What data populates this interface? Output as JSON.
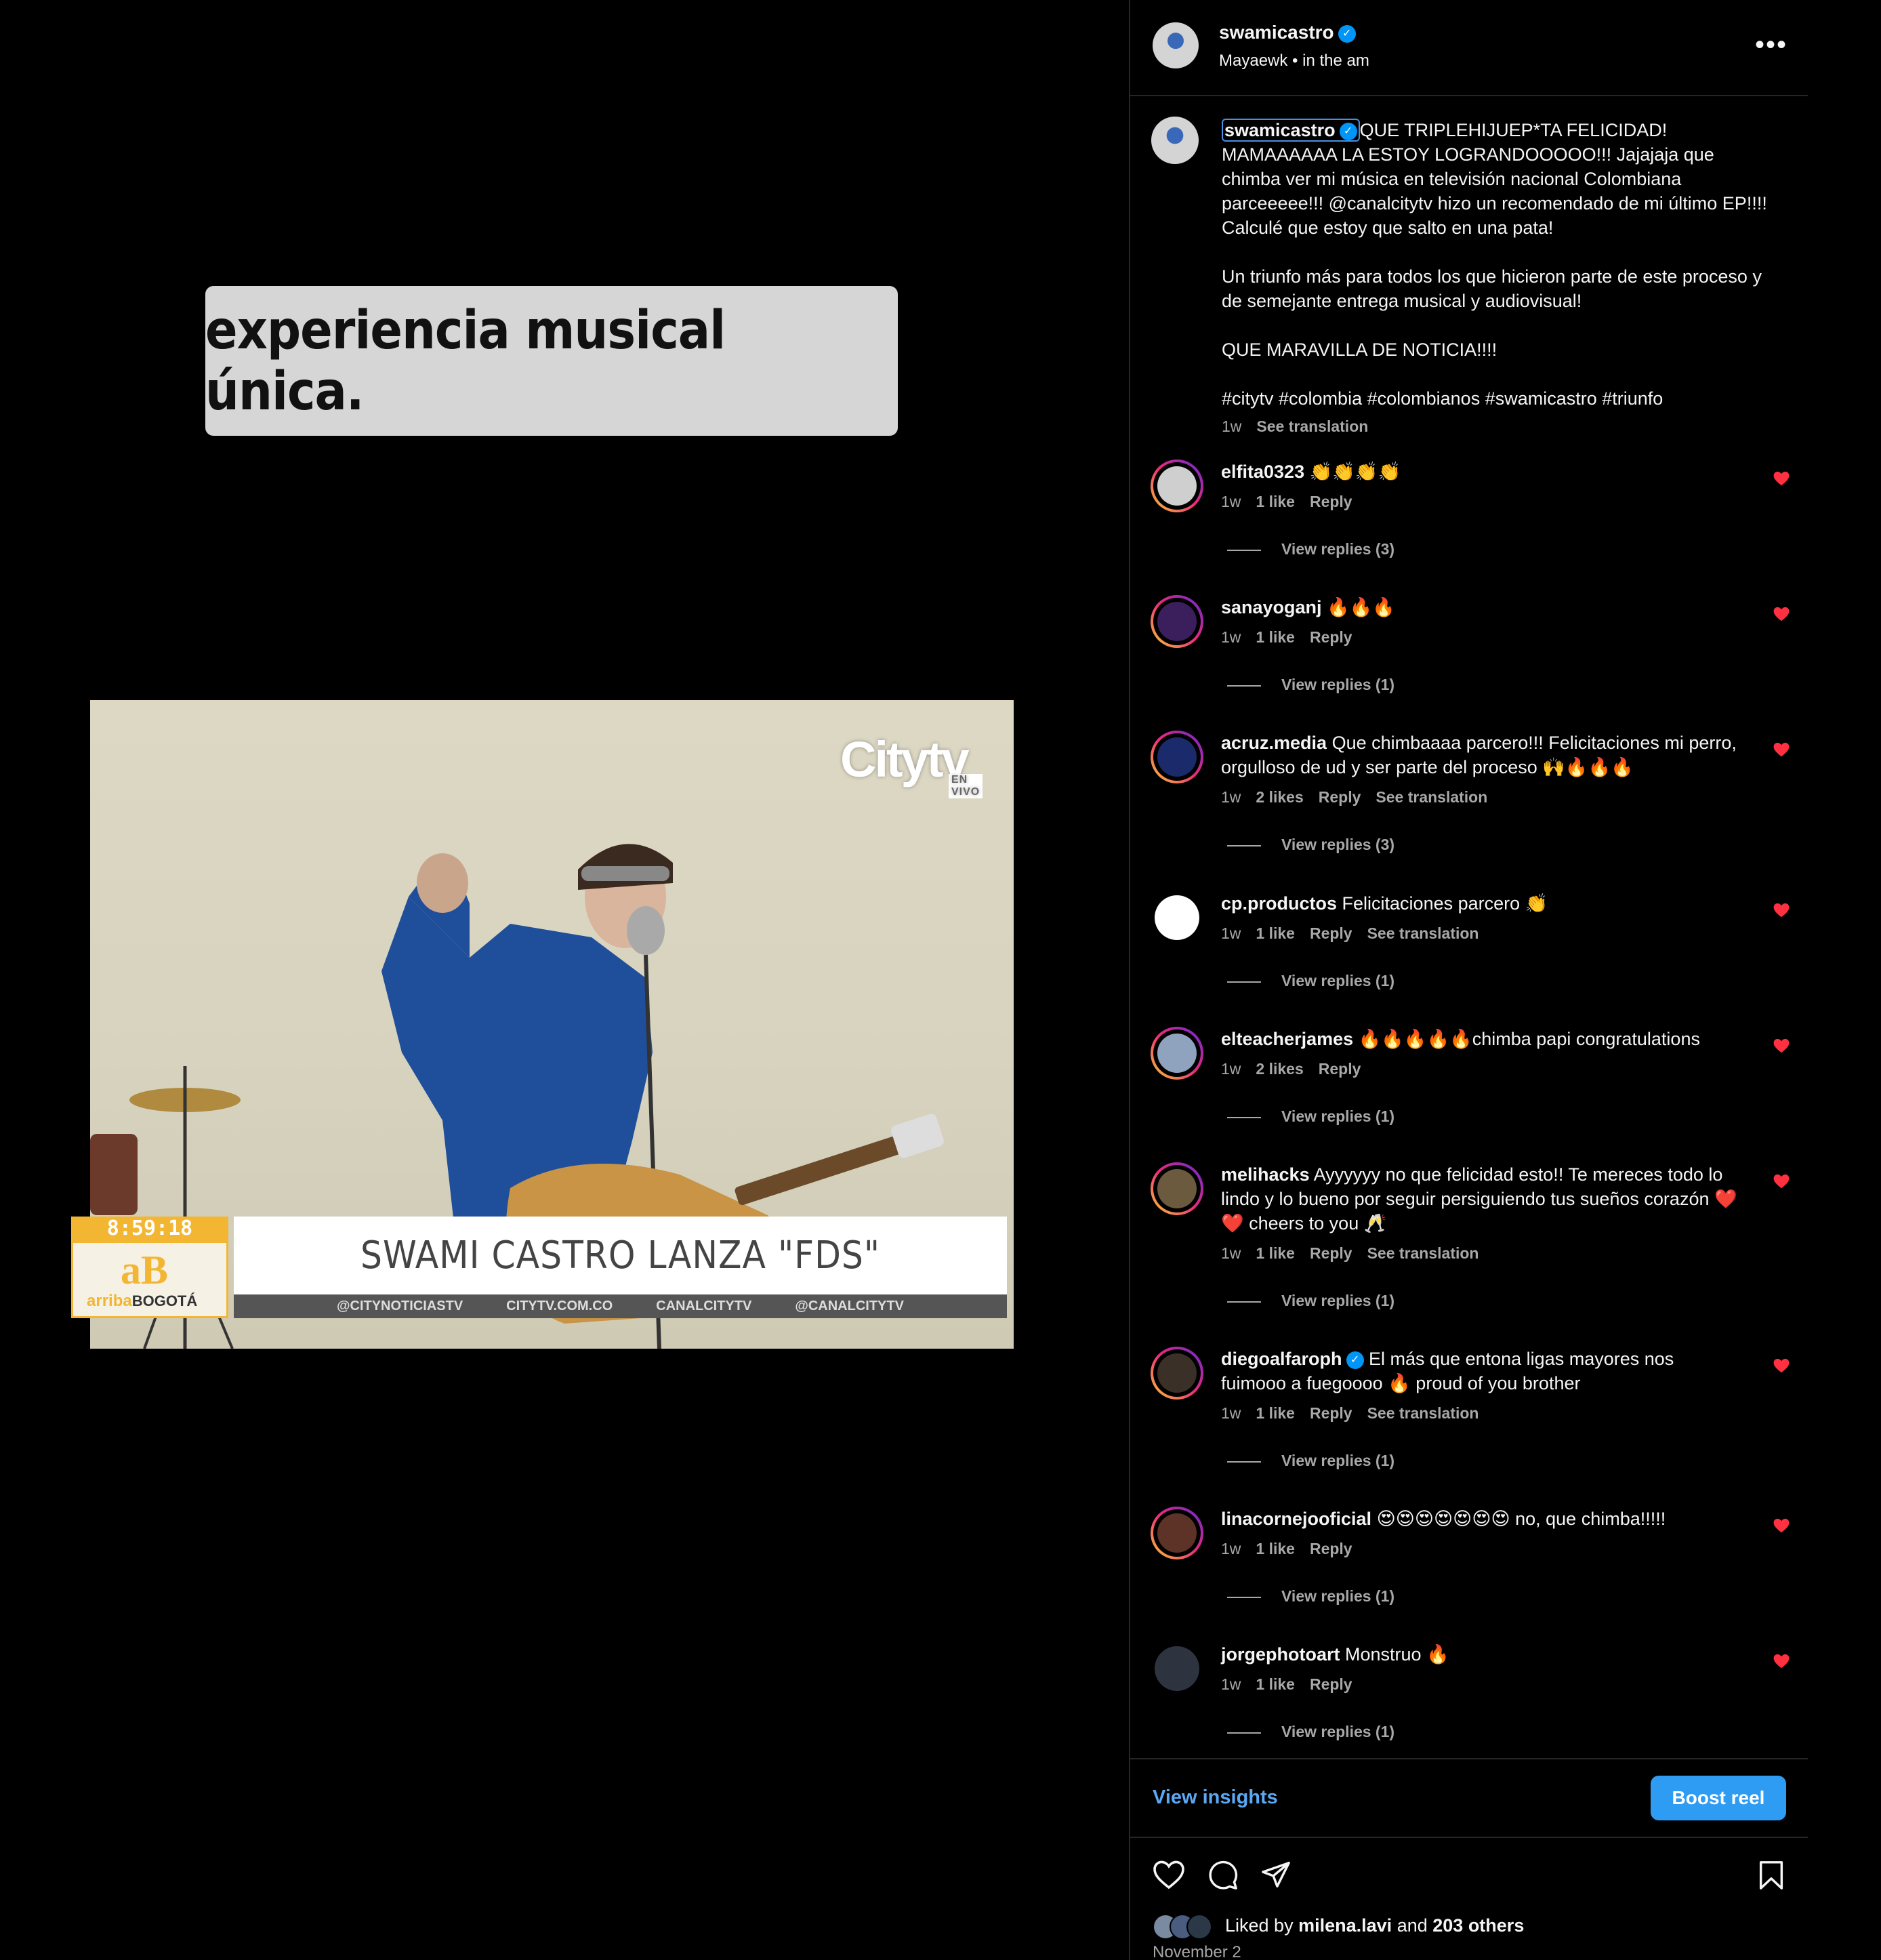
{
  "media": {
    "caption": "experiencia musical única.",
    "tv": {
      "channel": "Citytv",
      "channel_sub": "EN VIVO",
      "clock": "8:59:18",
      "show_logo": "aB",
      "show_name_a": "arriba",
      "show_name_b": "BOGOTÁ",
      "headline": "SWAMI CASTRO LANZA \"FDS\"",
      "ticker": [
        "@CITYNOTICIASTV",
        "CITYTV.COM.CO",
        "CANALCITYTV",
        "@CANALCITYTV"
      ]
    }
  },
  "header": {
    "username": "swamicastro",
    "location": "Mayaewk",
    "audio": "in the am",
    "more": "•••"
  },
  "post": {
    "username": "swamicastro",
    "text": "QUE TRIPLEHIJUEP*TA FELICIDAD! MAMAAAAAA LA ESTOY LOGRANDOOOOO!!! Jajajaja que chimba ver mi música en televisión nacional Colombiana parceeeee!!! @canalcitytv hizo un recomendado de mi último EP!!!! Calculé que estoy que salto en una pata!\n\nUn triunfo más para todos los que hicieron parte de este proceso y de semejante entrega musical y audiovisual!\n\nQUE MARAVILLA DE NOTICIA!!!!\n\n#citytv #colombia #colombianos #swamicastro #triunfo",
    "time": "1w",
    "see_translation": "See translation"
  },
  "comments": [
    {
      "user": "elfita0323",
      "verified": false,
      "text": "👏👏👏👏",
      "time": "1w",
      "likes": "1 like",
      "reply": "Reply",
      "translate": "",
      "replies": "View replies (3)",
      "avatar_color": "#cfcfcf",
      "ring": true
    },
    {
      "user": "sanayoganj",
      "verified": false,
      "text": "🔥🔥🔥",
      "time": "1w",
      "likes": "1 like",
      "reply": "Reply",
      "translate": "",
      "replies": "View replies (1)",
      "avatar_color": "#3a1f5c",
      "ring": true
    },
    {
      "user": "acruz.media",
      "verified": false,
      "text": "Que chimbaaaa parcero!!! Felicitaciones mi perro, orgulloso de ud y ser parte del proceso 🙌🔥🔥🔥",
      "time": "1w",
      "likes": "2 likes",
      "reply": "Reply",
      "translate": "See translation",
      "replies": "View replies (3)",
      "avatar_color": "#1b2a6b",
      "ring": true
    },
    {
      "user": "cp.productos",
      "verified": false,
      "text": "Felicitaciones parcero 👏",
      "time": "1w",
      "likes": "1 like",
      "reply": "Reply",
      "translate": "See translation",
      "replies": "View replies (1)",
      "avatar_color": "#ffffff",
      "ring": false
    },
    {
      "user": "elteacherjames",
      "verified": false,
      "text": "🔥🔥🔥🔥🔥chimba papi congratulations",
      "time": "1w",
      "likes": "2 likes",
      "reply": "Reply",
      "translate": "",
      "replies": "View replies (1)",
      "avatar_color": "#8fa3bf",
      "ring": true
    },
    {
      "user": "melihacks",
      "verified": false,
      "text": "Ayyyyyy no que felicidad esto!! Te mereces todo lo lindo y lo bueno por seguir persiguiendo tus sueños corazón ❤️❤️ cheers to you 🥂",
      "time": "1w",
      "likes": "1 like",
      "reply": "Reply",
      "translate": "See translation",
      "replies": "View replies (1)",
      "avatar_color": "#6b5a3e",
      "ring": true
    },
    {
      "user": "diegoalfaroph",
      "verified": true,
      "text": "El más que entona ligas mayores nos fuimooo a fuegoooo 🔥 proud of you brother",
      "time": "1w",
      "likes": "1 like",
      "reply": "Reply",
      "translate": "See translation",
      "replies": "View replies (1)",
      "avatar_color": "#3b3028",
      "ring": true
    },
    {
      "user": "linacornejooficial",
      "verified": false,
      "text": "😍😍😍😍😍😍😍 no, que chimba!!!!!",
      "time": "1w",
      "likes": "1 like",
      "reply": "Reply",
      "translate": "",
      "replies": "View replies (1)",
      "avatar_color": "#5c3326",
      "ring": true
    },
    {
      "user": "jorgephotoart",
      "verified": false,
      "text": "Monstruo 🔥",
      "time": "1w",
      "likes": "1 like",
      "reply": "Reply",
      "translate": "",
      "replies": "View replies (1)",
      "avatar_color": "#2e3340",
      "ring": false
    }
  ],
  "footer": {
    "view_insights": "View insights",
    "boost": "Boost reel",
    "liked_prefix": "Liked by",
    "liked_user": "milena.lavi",
    "liked_and": "and",
    "liked_others": "203 others",
    "date": "November 2"
  },
  "colors": {
    "accent": "#0095f6",
    "link": "#5aa9f7",
    "heart": "#ff3040",
    "muted": "#a8a8a8"
  }
}
